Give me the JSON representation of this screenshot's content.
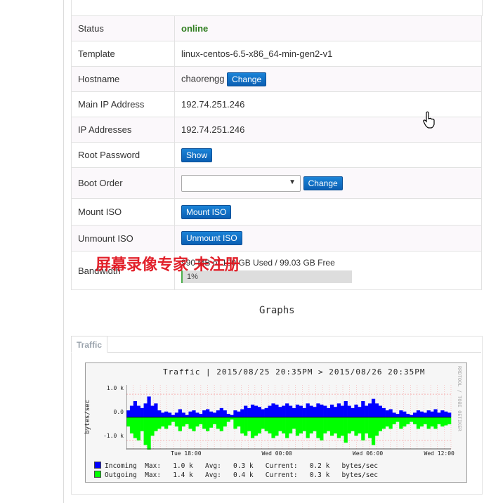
{
  "server_info": {
    "rows": [
      {
        "key": "status",
        "label": "Status",
        "value": "online"
      },
      {
        "key": "template",
        "label": "Template",
        "value": "linux-centos-6.5-x86_64-min-gen2-v1"
      },
      {
        "key": "hostname",
        "label": "Hostname",
        "value": "chaorengg",
        "button": "Change"
      },
      {
        "key": "main_ip",
        "label": "Main IP Address",
        "value": "192.74.251.246"
      },
      {
        "key": "ip_addresses",
        "label": "IP Addresses",
        "value": "192.74.251.246"
      },
      {
        "key": "root_password",
        "label": "Root Password",
        "button": "Show"
      },
      {
        "key": "boot_order",
        "label": "Boot Order",
        "select_value": "",
        "button": "Change"
      },
      {
        "key": "mount_iso",
        "label": "Mount ISO",
        "button": "Mount ISO"
      },
      {
        "key": "unmount_iso",
        "label": "Unmount ISO",
        "button": "Unmount ISO"
      },
      {
        "key": "bandwidth",
        "label": "Bandwidth",
        "value": "990 MB of 100 GB Used / 99.03 GB Free",
        "percent_label": "1%",
        "percent": 1
      }
    ]
  },
  "watermark": "屏幕录像专家 未注册",
  "graphs": {
    "title": "Graphs",
    "tab_label": "Traffic",
    "traffic": {
      "header": "Traffic | 2015/08/25 20:35PM > 2015/08/26 20:35PM",
      "credit": "RRDTOOL / TOBI OETIKER",
      "ylabel": "bytes/sec",
      "legend": {
        "incoming": "Incoming  Max:   1.0 k   Avg:   0.3 k   Current:   0.2 k   bytes/sec",
        "outgoing": "Outgoing  Max:   1.4 k   Avg:   0.4 k   Current:   0.3 k   bytes/sec"
      },
      "colors": {
        "incoming": "#0000ff",
        "outgoing": "#00ff00",
        "grid": "#f5a0a0",
        "axis": "#222222"
      }
    }
  },
  "chart_data": {
    "type": "area",
    "title": "Traffic | 2015/08/25 20:35PM > 2015/08/26 20:35PM",
    "ylabel": "bytes/sec",
    "ylim": [
      -1.4,
      1.4
    ],
    "yticks": [
      1.0,
      0.0,
      -1.0
    ],
    "ytick_labels": [
      "1.0 k",
      "0.0",
      "-1.0 k"
    ],
    "xtick_labels": [
      "Tue 18:00",
      "Wed 00:00",
      "Wed 06:00",
      "Wed 12:00"
    ],
    "xtick_positions": [
      0.18,
      0.46,
      0.74,
      0.96
    ],
    "series": [
      {
        "name": "Incoming",
        "values": [
          0.3,
          0.5,
          0.7,
          0.5,
          0.4,
          0.6,
          0.9,
          0.5,
          0.6,
          0.3,
          0.2,
          0.25,
          0.2,
          0.1,
          0.2,
          0.35,
          0.2,
          0.1,
          0.25,
          0.3,
          0.2,
          0.15,
          0.3,
          0.35,
          0.25,
          0.2,
          0.3,
          0.4,
          0.3,
          0.15,
          0.1,
          0.3,
          0.25,
          0.35,
          0.5,
          0.4,
          0.55,
          0.5,
          0.45,
          0.35,
          0.4,
          0.5,
          0.6,
          0.55,
          0.45,
          0.5,
          0.6,
          0.5,
          0.4,
          0.55,
          0.5,
          0.4,
          0.6,
          0.5,
          0.45,
          0.6,
          0.55,
          0.5,
          0.4,
          0.55,
          0.45,
          0.6,
          0.5,
          0.7,
          0.5,
          0.4,
          0.55,
          0.45,
          0.7,
          0.5,
          0.6,
          0.8,
          0.6,
          0.5,
          0.4,
          0.3,
          0.35,
          0.2,
          0.15,
          0.3,
          0.25,
          0.15,
          0.1,
          0.2,
          0.3,
          0.25,
          0.2,
          0.3,
          0.25,
          0.35,
          0.2,
          0.3,
          0.25,
          0.2
        ]
      },
      {
        "name": "Outgoing",
        "values": [
          0.4,
          0.7,
          0.9,
          1.0,
          0.6,
          1.2,
          1.4,
          0.8,
          0.6,
          0.5,
          0.4,
          0.5,
          0.35,
          0.2,
          0.4,
          0.6,
          0.4,
          0.3,
          0.5,
          0.6,
          0.4,
          0.3,
          0.5,
          0.6,
          0.45,
          0.3,
          0.5,
          0.6,
          0.4,
          0.2,
          0.1,
          0.5,
          0.4,
          0.7,
          0.8,
          0.6,
          0.9,
          0.8,
          0.7,
          0.5,
          0.6,
          0.7,
          0.9,
          0.8,
          0.6,
          0.7,
          0.9,
          0.7,
          0.5,
          0.8,
          0.7,
          0.6,
          0.9,
          0.7,
          0.6,
          0.9,
          1.0,
          0.7,
          0.6,
          0.8,
          0.7,
          0.9,
          0.8,
          1.1,
          0.7,
          0.6,
          0.8,
          0.7,
          1.0,
          0.7,
          0.9,
          1.2,
          0.8,
          0.6,
          0.5,
          0.4,
          0.5,
          0.3,
          0.2,
          0.5,
          0.4,
          0.3,
          0.2,
          0.3,
          0.5,
          0.4,
          0.3,
          0.5,
          0.4,
          0.5,
          0.3,
          0.4,
          0.35,
          0.3
        ]
      }
    ],
    "grid": true,
    "legend": "bottom"
  }
}
